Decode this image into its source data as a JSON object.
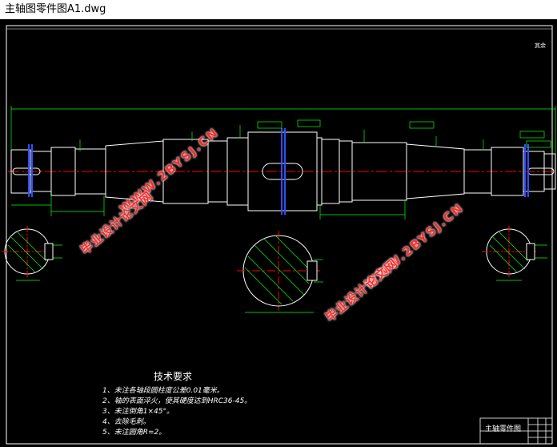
{
  "window": {
    "title": "主轴图零件图A1.dwg"
  },
  "drawing": {
    "roughness_note": "其余",
    "tech_requirements": {
      "title": "技术要求",
      "items": [
        "1、未注各轴段圆柱度公差0.01毫米。",
        "2、轴的表面淬火，使其硬度达到HRC36-45。",
        "3、未注倒角1×45°。",
        "4、去除毛刺。",
        "5、未注圆角R=2。"
      ]
    },
    "title_block": {
      "name": "主轴零件图"
    }
  },
  "watermarks": {
    "url": "WWW.2BYSJ.CN",
    "cn": "毕业设计论文网"
  },
  "colors": {
    "background": "#000000",
    "outline": "#ffffff",
    "dimension": "#00ff00",
    "centerline": "#ff0000",
    "keyway": "#3050ff",
    "watermark": "#ff2a2a"
  }
}
